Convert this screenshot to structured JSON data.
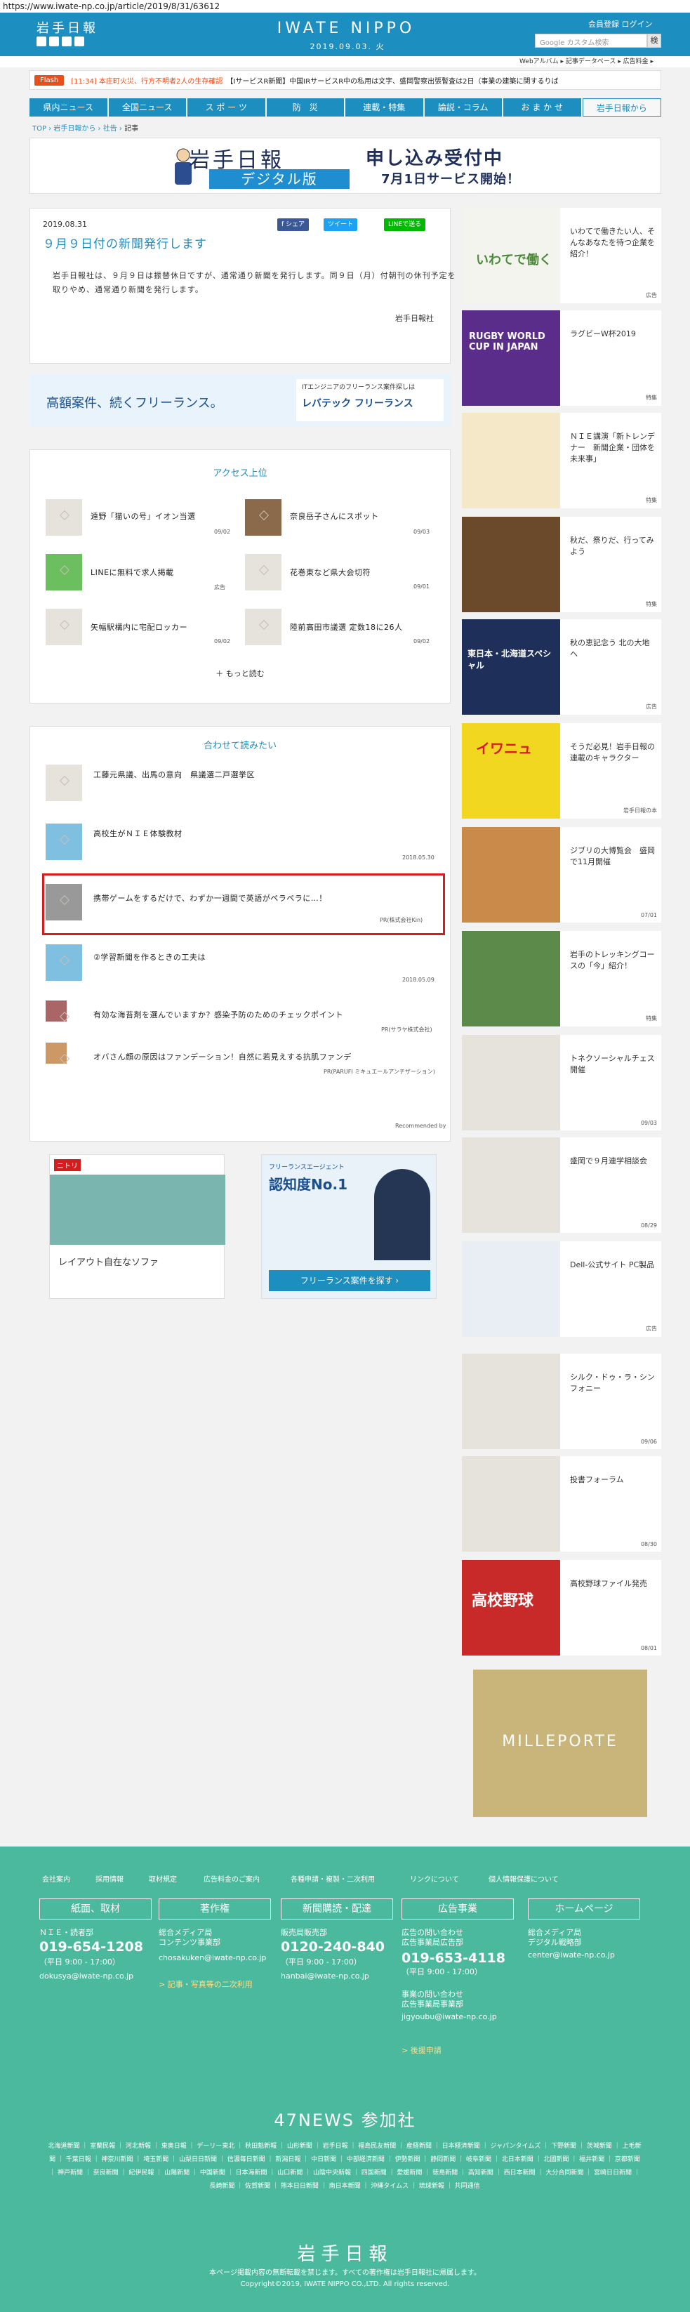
{
  "url": "https://www.iwate-np.co.jp/article/2019/8/31/63612",
  "header": {
    "logo": "岩手日報",
    "brand": "IWATE NIPPO",
    "date": "2019.09.03. 火",
    "links": "会員登録  ログイン",
    "search_placeholder": "Google カスタム検索",
    "search_btn": "検",
    "sublinks": "Webアルバム ▸   記事データベース ▸   広告料金 ▸"
  },
  "flash": {
    "label": "Flash",
    "time": "[11:34]",
    "headline": "本庄町火災、行方不明者2人の生存確認",
    "rest": "【IサービスR新聞】中国IRサービスR中の私用は文字、盛岡警察出張暫査は2日（事業の建築に関するりば"
  },
  "nav": [
    "県内ニュース",
    "全国ニュース",
    "ス ポ ー ツ",
    "防　災",
    "連載・特集",
    "論説・コラム",
    "お ま か せ",
    "岩手日報から"
  ],
  "breadcrumb": {
    "top": "TOP",
    "mid": "岩手日報から",
    "sec": "社告",
    "cur": "記事"
  },
  "banner": {
    "logo": "岩手日報",
    "digital": "デジタル版",
    "title": "申し込み受付中",
    "sub": "7月1日サービス開始！"
  },
  "article": {
    "date": "2019.08.31",
    "title": "９月９日付の新聞発行します",
    "share": "f シェア",
    "tweet": "ツイート",
    "line": "LINEで送る",
    "body": "岩手日報社は、９月９日は振替休日ですが、通常通り新聞を発行します。同９日（月）付朝刊の休刊予定を取りやめ、通常通り新聞を発行します。",
    "sign": "岩手日報社"
  },
  "ad1": {
    "left": "高額案件、続くフリーランス。",
    "right_small": "ITエンジニアのフリーランス案件探しは",
    "right_brand": "レバテック フリーランス"
  },
  "access": {
    "title": "アクセス上位",
    "items": [
      {
        "t": "遠野「猫いの号」イオン当選",
        "d": "09/02"
      },
      {
        "t": "奈良岳子さんにスポット",
        "d": "09/03"
      },
      {
        "t": "LINEに無料で求人掲載",
        "d": "広告"
      },
      {
        "t": "花巻東など県大会切符",
        "d": "09/01"
      },
      {
        "t": "矢幅駅構内に宅配ロッカー",
        "d": "09/02"
      },
      {
        "t": "陸前高田市議選 定数18に26人",
        "d": "09/02"
      }
    ],
    "more": "もっと読む"
  },
  "related": {
    "title": "合わせて読みたい",
    "items": [
      {
        "t": "工藤元県議、出馬の意向　県議選二戸選挙区",
        "d": ""
      },
      {
        "t": "高校生がＮＩＥ体験教材",
        "d": "2018.05.30"
      },
      {
        "t": "携帯ゲームをするだけで、わずか一週間で英語がペラペラに…！",
        "d": "PR(株式会社Kin)"
      },
      {
        "t": "②学習新聞を作るときの工夫は",
        "d": "2018.05.09"
      },
      {
        "t": "有効な海苔剤を選んでいますか？感染予防のためのチェックポイント",
        "d": "PR(サラヤ株式会社)"
      },
      {
        "t": "オバさん顔の原因はファンデーション！自然に若見えする抗肌ファンデ",
        "d": "PR(PARUFI ミキュエールアンチザーション)"
      }
    ],
    "footer": "Recommended by"
  },
  "ads": {
    "nitori": "ニトリ",
    "sofa": "レイアウト自在なソファ",
    "lev_badge": "認知度No.1",
    "lev_text": "フリーランス案件を探す ›",
    "lev_top": "フリーランスエージェント"
  },
  "right": [
    {
      "t": "いわてで働きたい人、そんなあなたを待つ企業を紹介！",
      "d": "広告",
      "img": "いわてで働く"
    },
    {
      "t": "ラグビーW杯2019",
      "d": "特集",
      "img": "RUGBY WORLD CUP IN JAPAN"
    },
    {
      "t": "ＮＩＥ講演「新トレンデナー　新聞企業・団体を未来事」",
      "d": "特集",
      "img": ""
    },
    {
      "t": "秋だ、祭りだ、行ってみよう",
      "d": "特集",
      "img": ""
    },
    {
      "t": "秋の恵記念う 北の大地へ",
      "d": "広告",
      "img": "東日本・北海道スペシャル"
    },
    {
      "t": "そうだ必見！岩手日報の連載のキャラクター",
      "d": "岩手日報の本",
      "img": "イワニュ"
    },
    {
      "t": "ジブリの大博覧会　盛岡で11月開催",
      "d": "07/01",
      "img": ""
    },
    {
      "t": "岩手のトレッキングコースの「今」紹介！",
      "d": "特集",
      "img": ""
    },
    {
      "t": "トネクソーシャルチェス開催",
      "d": "09/03",
      "img": ""
    },
    {
      "t": "盛岡で９月連学相談会",
      "d": "08/29",
      "img": ""
    },
    {
      "t": "Dell-公式サイト PC製品",
      "d": "広告",
      "img": ""
    },
    {
      "t": "シルク・ドゥ・ラ・シンフォニー",
      "d": "09/06",
      "img": ""
    },
    {
      "t": "投書フォーラム",
      "d": "08/30",
      "img": ""
    },
    {
      "t": "高校野球ファイル発売",
      "d": "08/01",
      "img": "高校野球"
    }
  ],
  "milleporte": "MILLEPORTE",
  "footer": {
    "links": [
      "会社案内",
      "採用情報",
      "取材規定",
      "広告料金のご案内",
      "各種申請・複製・二次利用",
      "リンクについて",
      "個人情報保護について"
    ],
    "boxes": [
      "紙面、取材",
      "著作権",
      "新聞購読・配達",
      "広告事業",
      "ホームページ"
    ],
    "c1": "ＮＩＥ・読者部",
    "p1": "019-654-1208",
    "h1": "（平日 9:00 - 17:00）",
    "m1": "dokusya@iwate-np.co.jp",
    "c2": "総合メディア局\nコンテンツ事業部",
    "m2": "chosakuken@iwate-np.co.jp",
    "l2": "> 記事・写真等の二次利用",
    "c3": "販売局販売部",
    "p3": "0120-240-840",
    "h3": "（平日 9:00 - 17:00）",
    "m3": "hanbai@iwate-np.co.jp",
    "c4": "広告の問い合わせ\n広告事業局広告部",
    "p4": "019-653-4118",
    "h4": "（平日 9:00 - 17:00）",
    "c4b": "事業の問い合わせ\n広告事業局事業部",
    "m4": "jigyoubu@iwate-np.co.jp",
    "l4": "> 後援申請",
    "c5": "総合メディア局\nデジタル戦略部",
    "m5": "center@iwate-np.co.jp",
    "news47": "47NEWS 参加社",
    "papers": "北海道新聞 ｜ 室蘭民報 ｜ 河北新報 ｜ 東奥日報 ｜ デーリー東北 ｜ 秋田魁新報 ｜ 山形新聞 ｜ 岩手日報 ｜ 福島民友新聞 ｜ 産経新聞 ｜ 日本経済新聞 ｜ ジャパンタイムズ ｜ 下野新聞 ｜ 茨城新聞 ｜ 上毛新聞 ｜ 千葉日報 ｜ 神奈川新聞 ｜ 埼玉新聞 ｜ 山梨日日新聞 ｜ 信濃毎日新聞 ｜ 新潟日報 ｜ 中日新聞 ｜ 中部経済新聞 ｜ 伊勢新聞 ｜ 静岡新聞 ｜ 岐阜新聞 ｜ 北日本新聞 ｜ 北國新聞 ｜ 福井新聞 ｜ 京都新聞 ｜ 神戸新聞 ｜ 奈良新聞 ｜ 紀伊民報 ｜ 山陽新聞 ｜ 中国新聞 ｜ 日本海新聞 ｜ 山口新聞 ｜ 山陰中央新報 ｜ 四国新聞 ｜ 愛媛新聞 ｜ 徳島新聞 ｜ 高知新聞 ｜ 西日本新聞 ｜ 大分合同新聞 ｜ 宮崎日日新聞 ｜ 長崎新聞 ｜ 佐賀新聞 ｜ 熊本日日新聞 ｜ 南日本新聞 ｜ 沖縄タイムス ｜ 琉球新報 ｜ 共同通信",
    "logo": "岩手日報",
    "copy1": "本ページ掲載内容の無断転載を禁じます。すべての著作権は岩手日報社に帰属します。",
    "copy2": "Copyright©2019, IWATE NIPPO CO.,LTD. All rights reserved."
  }
}
